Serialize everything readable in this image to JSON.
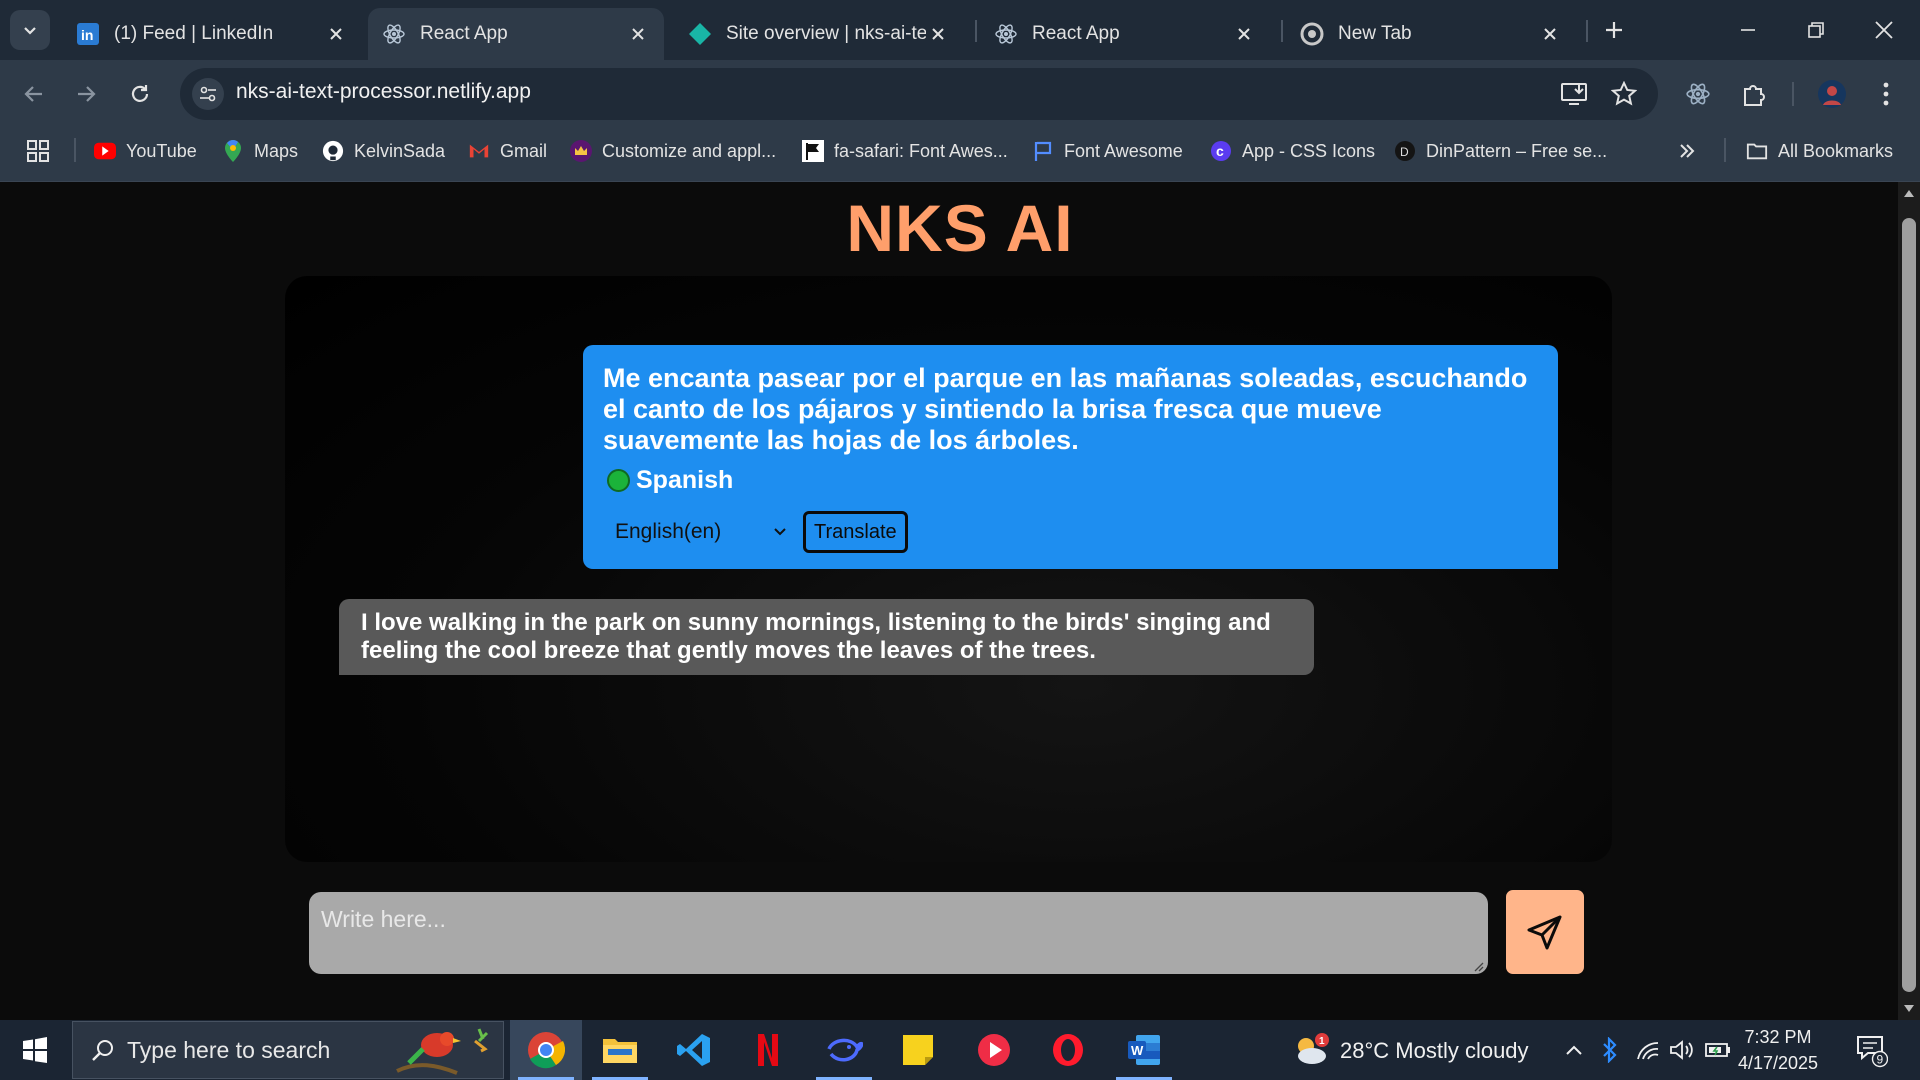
{
  "browser": {
    "tabs": [
      {
        "title": "(1) Feed | LinkedIn",
        "icon": "linkedin-icon",
        "active": false
      },
      {
        "title": "React App",
        "icon": "react-icon",
        "active": true
      },
      {
        "title": "Site overview | nks-ai-text",
        "icon": "netlify-icon",
        "active": false
      },
      {
        "title": "React App",
        "icon": "react-icon",
        "active": false
      },
      {
        "title": "New Tab",
        "icon": "chrome-icon",
        "active": false
      }
    ],
    "url": "nks-ai-text-processor.netlify.app",
    "bookmarks": [
      {
        "label": "YouTube",
        "icon": "youtube-icon"
      },
      {
        "label": "Maps",
        "icon": "maps-icon"
      },
      {
        "label": "KelvinSada",
        "icon": "github-icon"
      },
      {
        "label": "Gmail",
        "icon": "gmail-icon"
      },
      {
        "label": "Customize and appl...",
        "icon": "crown-icon"
      },
      {
        "label": "fa-safari: Font Awes...",
        "icon": "flag-icon"
      },
      {
        "label": "Font Awesome",
        "icon": "flag-outline-icon"
      },
      {
        "label": "App - CSS Icons",
        "icon": "css-icons-icon"
      },
      {
        "label": "DinPattern – Free se...",
        "icon": "dinpattern-icon"
      }
    ],
    "all_bookmarks": "All Bookmarks"
  },
  "app": {
    "brand": "NKS AI",
    "source_message": "Me encanta pasear por el parque en las mañanas soleadas, escuchando el canto de los pájaros y sintiendo la brisa fresca que mueve suavemente las hojas de los árboles.",
    "detected_language": "Spanish",
    "target_language": "English(en)",
    "translate_label": "Translate",
    "translated_message": "I love walking in the park on sunny mornings, listening to the birds' singing and feeling the cool breeze that gently moves the leaves of the trees.",
    "input_placeholder": "Write here...",
    "colors": {
      "brand": "#ff9f6b",
      "source_bubble": "#1e8ef0",
      "output_bubble": "#595959",
      "send_button": "#ffb58a",
      "detected_dot": "#1bb33a"
    }
  },
  "taskbar": {
    "search_placeholder": "Type here to search",
    "weather": "28°C  Mostly cloudy",
    "weather_badge": "1",
    "time": "7:32 PM",
    "date": "4/17/2025",
    "notification_count": "9",
    "apps": [
      "chrome-icon",
      "file-explorer-icon",
      "vscode-icon",
      "netflix-icon",
      "deepseek-icon",
      "sticky-notes-icon",
      "media-player-icon",
      "opera-icon",
      "word-icon"
    ]
  }
}
